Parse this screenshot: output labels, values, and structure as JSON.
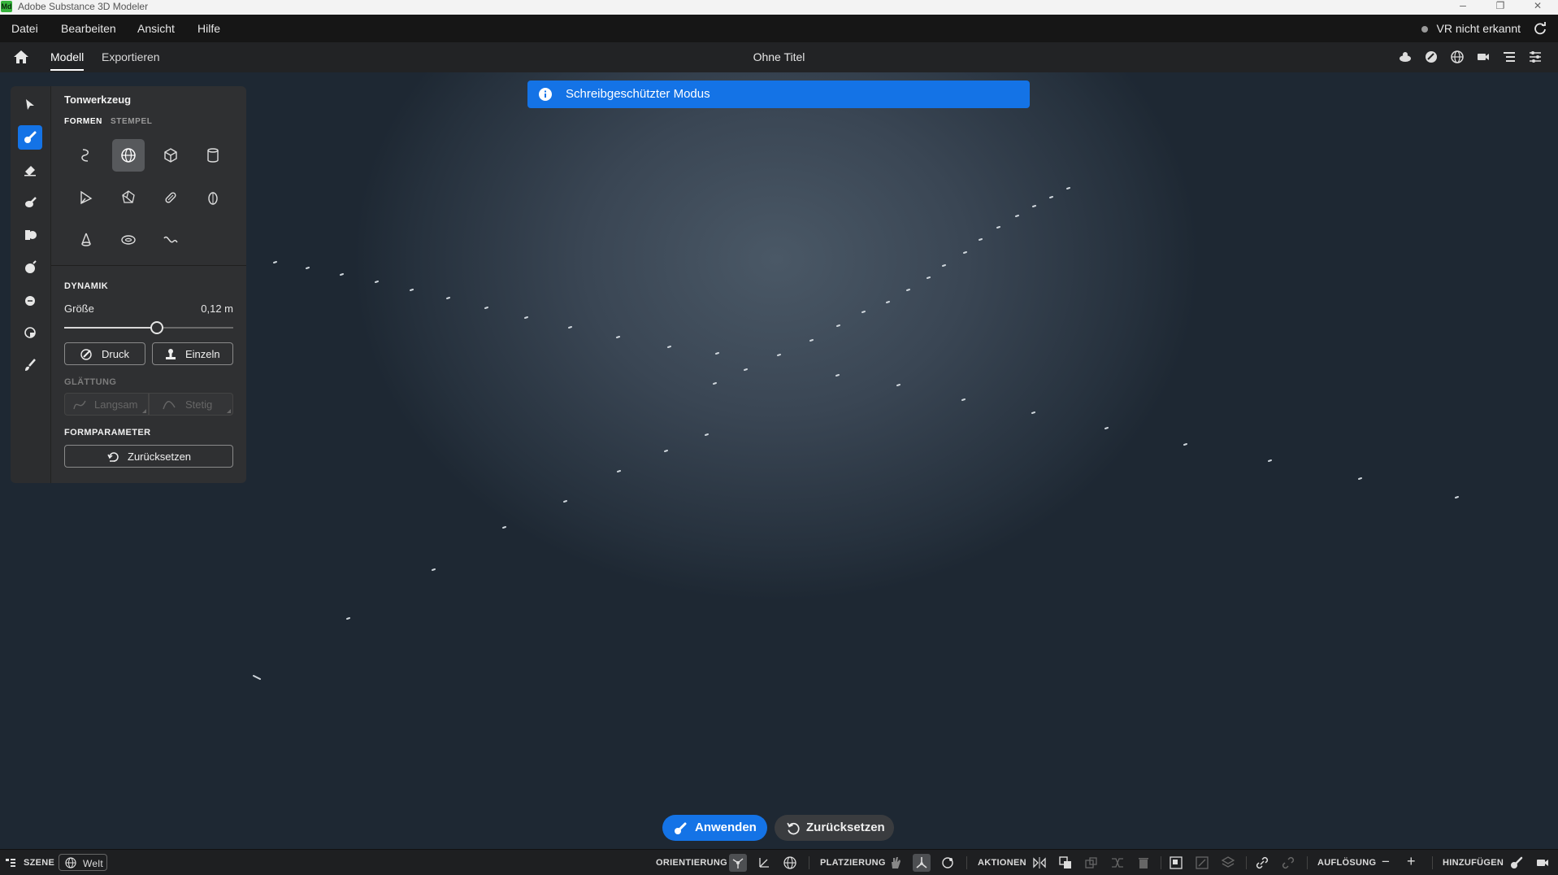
{
  "window": {
    "title": "Adobe Substance 3D Modeler",
    "logo_text": "Md",
    "minimize": "–",
    "maximize": "❐",
    "close": "✕"
  },
  "menu": {
    "items": [
      "Datei",
      "Bearbeiten",
      "Ansicht",
      "Hilfe"
    ],
    "vr_status": "VR nicht erkannt"
  },
  "tabs": {
    "items": [
      "Modell",
      "Exportieren"
    ],
    "active": "Modell",
    "document_title": "Ohne Titel"
  },
  "banner": {
    "text": "Schreibgeschützter Modus"
  },
  "panel": {
    "title": "Tonwerkzeug",
    "tab_shapes": "FORMEN",
    "tab_stamps": "STEMPEL",
    "dynamics_heading": "DYNAMIK",
    "size_label": "Größe",
    "size_value": "0,12 m",
    "size_slider_fraction": 0.55,
    "pressure_label": "Druck",
    "single_label": "Einzeln",
    "smoothing_heading": "GLÄTTUNG",
    "slow_label": "Langsam",
    "steady_label": "Stetig",
    "shape_params_heading": "FORMPARAMETER",
    "reset_label": "Zurücksetzen"
  },
  "actions": {
    "apply": "Anwenden",
    "reset": "Zurücksetzen"
  },
  "statusbar": {
    "scene": "SZENE",
    "world": "Welt",
    "orientation": "ORIENTIERUNG",
    "placement": "PLATZIERUNG",
    "actions": "AKTIONEN",
    "resolution": "AUFLÖSUNG",
    "resolution_minus": "−",
    "resolution_plus": "+",
    "add": "HINZUFÜGEN"
  },
  "colors": {
    "accent": "#1473e6",
    "panel": "#2f3032",
    "toolbar": "#2c2d2f"
  }
}
